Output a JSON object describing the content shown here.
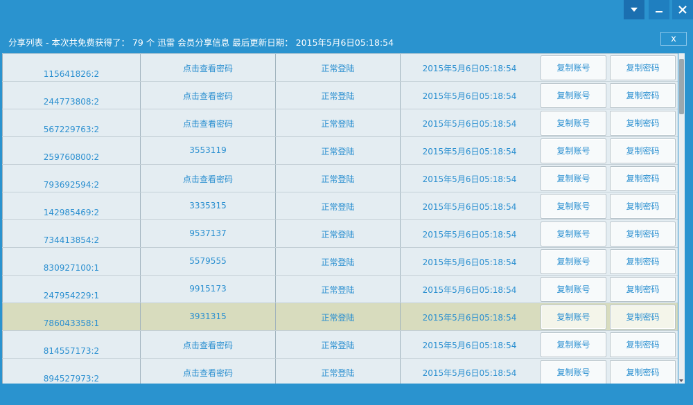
{
  "header": {
    "title": "分享列表 - 本次共免费获得了： 79 个 迅雷 会员分享信息 最后更新日期： 2015年5月6日05:18:54",
    "panel_close": "x"
  },
  "buttons": {
    "copy_account": "复制账号",
    "copy_password": "复制密码"
  },
  "rows": [
    {
      "account": "115641826:2",
      "password": "点击查看密码",
      "status": "正常登陆",
      "date": "2015年5月6日05:18:54"
    },
    {
      "account": "244773808:2",
      "password": "点击查看密码",
      "status": "正常登陆",
      "date": "2015年5月6日05:18:54"
    },
    {
      "account": "567229763:2",
      "password": "点击查看密码",
      "status": "正常登陆",
      "date": "2015年5月6日05:18:54"
    },
    {
      "account": "259760800:2",
      "password": "3553119",
      "status": "正常登陆",
      "date": "2015年5月6日05:18:54"
    },
    {
      "account": "793692594:2",
      "password": "点击查看密码",
      "status": "正常登陆",
      "date": "2015年5月6日05:18:54"
    },
    {
      "account": "142985469:2",
      "password": "3335315",
      "status": "正常登陆",
      "date": "2015年5月6日05:18:54"
    },
    {
      "account": "734413854:2",
      "password": "9537137",
      "status": "正常登陆",
      "date": "2015年5月6日05:18:54"
    },
    {
      "account": "830927100:1",
      "password": "5579555",
      "status": "正常登陆",
      "date": "2015年5月6日05:18:54"
    },
    {
      "account": "247954229:1",
      "password": "9915173",
      "status": "正常登陆",
      "date": "2015年5月6日05:18:54"
    },
    {
      "account": "786043358:1",
      "password": "3931315",
      "status": "正常登陆",
      "date": "2015年5月6日05:18:54",
      "selected": true
    },
    {
      "account": "814557173:2",
      "password": "点击查看密码",
      "status": "正常登陆",
      "date": "2015年5月6日05:18:54"
    },
    {
      "account": "894527973:2",
      "password": "点击查看密码",
      "status": "正常登陆",
      "date": "2015年5月6日05:18:54"
    }
  ],
  "icons": {
    "menu": "dropdown-triangle-icon",
    "minimize": "minimize-icon",
    "close": "close-icon"
  },
  "colors": {
    "background": "#2a93cf",
    "link_text": "#2a8fd0",
    "row": "#e4edf2",
    "row_selected": "#d8dcbe"
  }
}
